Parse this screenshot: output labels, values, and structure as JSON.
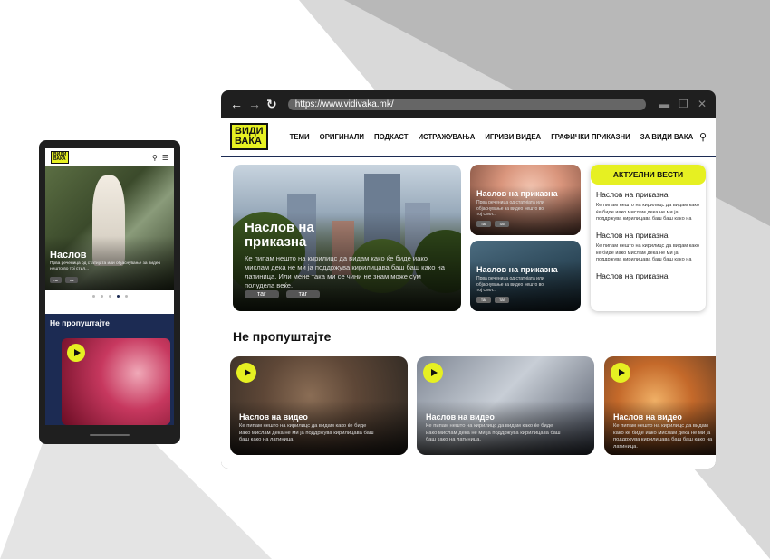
{
  "colors": {
    "accent": "#e6f022",
    "navy": "#1c2b53",
    "frame": "#1f1f1f"
  },
  "mobile": {
    "logo_line1": "ВИДИ",
    "logo_line2": "ВАКА",
    "hero": {
      "title": "Наслов",
      "desc": "Прва реченица од статијата или објаснување за видео нешто во тој стил...",
      "tags": [
        "таг",
        "таг"
      ]
    },
    "section_title": "Не пропуштајте"
  },
  "browser": {
    "url": "https://www.vidivaka.mk/",
    "logo_line1": "ВИДИ",
    "logo_line2": "ВАКА",
    "menu": [
      "ТЕМИ",
      "ОРИГИНАЛИ",
      "ПОДКАСТ",
      "ИСТРАЖУВАЊА",
      "ИГРИВИ ВИДЕА",
      "ГРАФИЧКИ ПРИКАЗНИ",
      "ЗА ВИДИ ВАКА"
    ],
    "hero": {
      "title": "Наслов на приказна",
      "desc": "Ке пипам нешто на кирилицс да видам како ќе биде иако мислам дека не ми ја поддржува кирилицава баш баш како на латиница. Или мене така ми се чини не знам може сум полудела веќе.",
      "tags": [
        "таг",
        "таг"
      ]
    },
    "stories": [
      {
        "title": "Наслов на приказна",
        "desc": "Прва реченица од статијата или објаснување за видео нешто во тој стил...",
        "tags": [
          "таг",
          "таг"
        ]
      },
      {
        "title": "Наслов на приказна",
        "desc": "Прва реченица од статијата или објаснување за видео нешто во тој стил...",
        "tags": [
          "таг",
          "таг"
        ]
      }
    ],
    "news": {
      "heading": "АКТУЕЛНИ ВЕСТИ",
      "items": [
        {
          "title": "Наслов на приказна",
          "desc": "Ке пипам нешто на кирилицс да видам како ќе биде иако мислам дека не ми ја поддржува кирилицава баш баш како на латиница. Или мене така ми се чини не знам може сум полудела веќе."
        },
        {
          "title": "Наслов на приказна",
          "desc": "Ке пипам нешто на кирилицс да видам како ќе биде иако мислам дека не ми ја поддржува кирилицава баш баш како на латиница. Или мене така ми се чини не знам може сум полудела веќе."
        },
        {
          "title": "Наслов на приказна"
        }
      ]
    },
    "section_title": "Не пропуштајте",
    "videos": [
      {
        "title": "Наслов на видео",
        "desc": "Ке пипам нешто на кирилицс да видам како ќе биде иако мислам дека не ми ја поддржува кирилицава баш баш како на латиница."
      },
      {
        "title": "Наслов на видео",
        "desc": "Ке пипам нешто на кирилицс да видам како ќе биде иако мислам дека не ми ја поддржува кирилицава баш баш како на латиница."
      },
      {
        "title": "Наслов на видео",
        "desc": "Ке пипам нешто на кирилицс да видам како ќе биде иако мислам дека не ми ја поддржува кирилицава баш баш како на латиница."
      }
    ]
  }
}
